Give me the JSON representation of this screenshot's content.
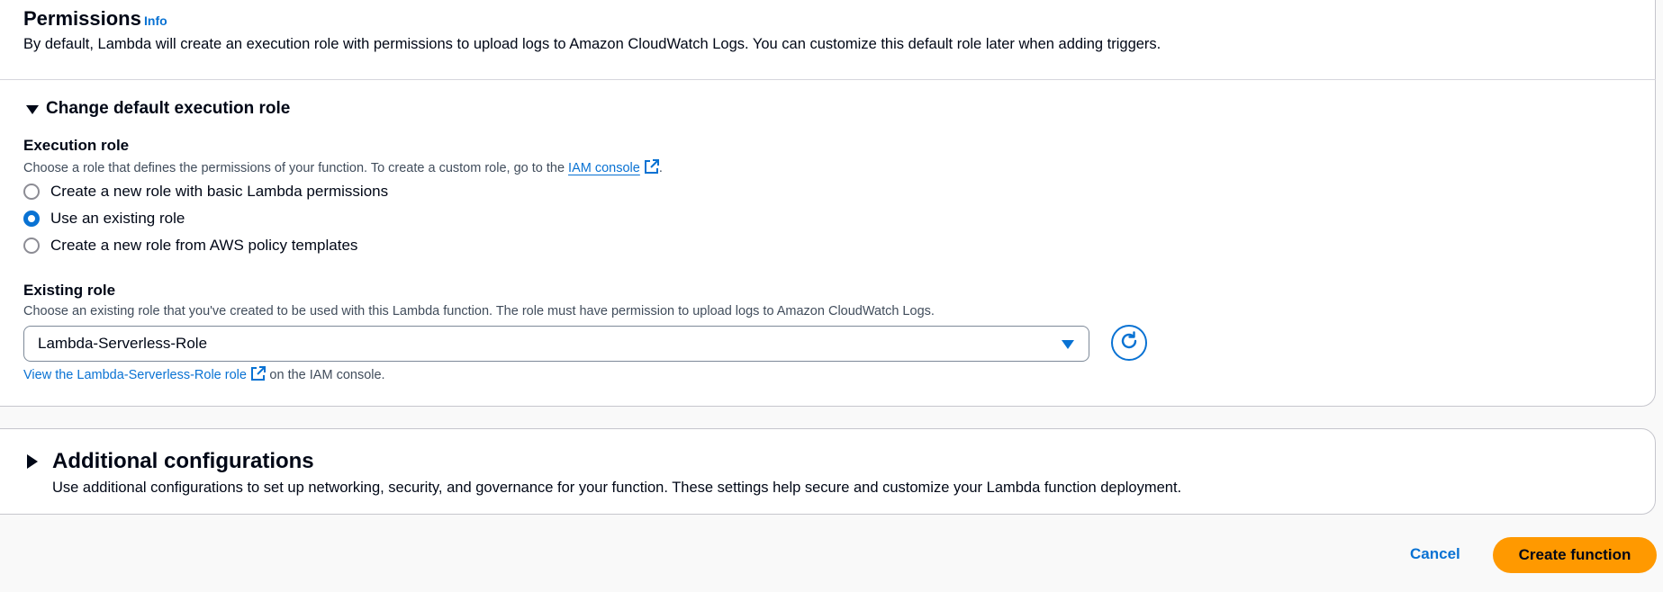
{
  "permissions": {
    "title": "Permissions",
    "info": "Info",
    "description": "By default, Lambda will create an execution role with permissions to upload logs to Amazon CloudWatch Logs. You can customize this default role later when adding triggers."
  },
  "change_role": {
    "title": "Change default execution role",
    "execution_role": {
      "label": "Execution role",
      "hint_prefix": "Choose a role that defines the permissions of your function. To create a custom role, go to the ",
      "hint_link": "IAM console",
      "hint_suffix": ".",
      "options": [
        {
          "label": "Create a new role with basic Lambda permissions",
          "selected": false
        },
        {
          "label": "Use an existing role",
          "selected": true
        },
        {
          "label": "Create a new role from AWS policy templates",
          "selected": false
        }
      ]
    },
    "existing_role": {
      "label": "Existing role",
      "hint": "Choose an existing role that you've created to be used with this Lambda function. The role must have permission to upload logs to Amazon CloudWatch Logs.",
      "value": "Lambda-Serverless-Role",
      "view_link": "View the Lambda-Serverless-Role role",
      "view_suffix": "on the IAM console."
    }
  },
  "additional": {
    "title": "Additional configurations",
    "description": "Use additional configurations to set up networking, security, and governance for your function. These settings help secure and customize your Lambda function deployment."
  },
  "actions": {
    "cancel": "Cancel",
    "create": "Create function"
  },
  "colors": {
    "accent": "#0972d3",
    "primary_button": "#ff9900"
  }
}
